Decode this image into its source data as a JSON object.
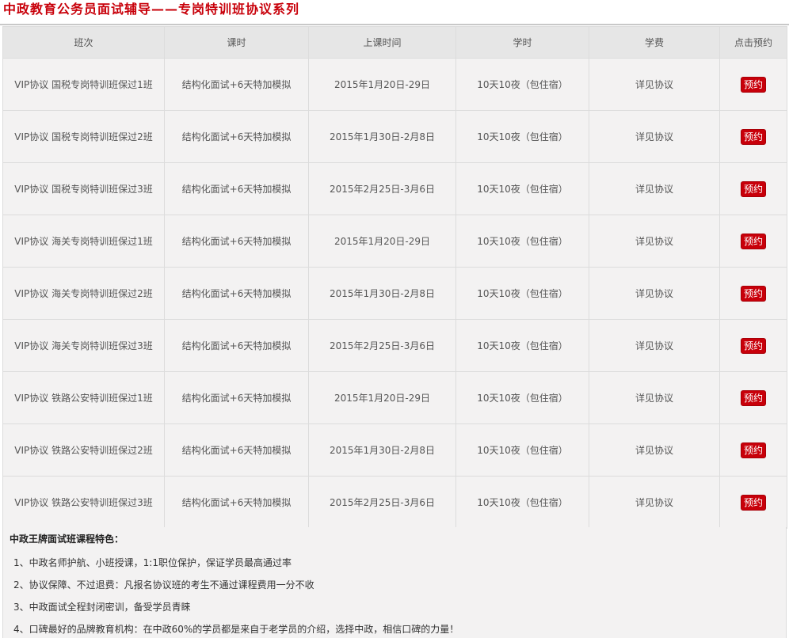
{
  "page_title": "中政教育公务员面试辅导——专岗特训班协议系列",
  "table": {
    "headers": [
      "班次",
      "课时",
      "上课时间",
      "学时",
      "学费",
      "点击预约"
    ],
    "rows": [
      {
        "class": "VIP协议 国税专岗特训班保过1班",
        "hours": "结构化面试+6天特加模拟",
        "time": "2015年1月20日-29日",
        "period": "10天10夜（包住宿）",
        "fee": "详见协议",
        "action": "预约"
      },
      {
        "class": "VIP协议 国税专岗特训班保过2班",
        "hours": "结构化面试+6天特加模拟",
        "time": "2015年1月30日-2月8日",
        "period": "10天10夜（包住宿）",
        "fee": "详见协议",
        "action": "预约"
      },
      {
        "class": "VIP协议 国税专岗特训班保过3班",
        "hours": "结构化面试+6天特加模拟",
        "time": "2015年2月25日-3月6日",
        "period": "10天10夜（包住宿）",
        "fee": "详见协议",
        "action": "预约"
      },
      {
        "class": "VIP协议 海关专岗特训班保过1班",
        "hours": "结构化面试+6天特加模拟",
        "time": "2015年1月20日-29日",
        "period": "10天10夜（包住宿）",
        "fee": "详见协议",
        "action": "预约"
      },
      {
        "class": "VIP协议 海关专岗特训班保过2班",
        "hours": "结构化面试+6天特加模拟",
        "time": "2015年1月30日-2月8日",
        "period": "10天10夜（包住宿）",
        "fee": "详见协议",
        "action": "预约"
      },
      {
        "class": "VIP协议 海关专岗特训班保过3班",
        "hours": "结构化面试+6天特加模拟",
        "time": "2015年2月25日-3月6日",
        "period": "10天10夜（包住宿）",
        "fee": "详见协议",
        "action": "预约"
      },
      {
        "class": "VIP协议 铁路公安特训班保过1班",
        "hours": "结构化面试+6天特加模拟",
        "time": "2015年1月20日-29日",
        "period": "10天10夜（包住宿）",
        "fee": "详见协议",
        "action": "预约"
      },
      {
        "class": "VIP协议 铁路公安特训班保过2班",
        "hours": "结构化面试+6天特加模拟",
        "time": "2015年1月30日-2月8日",
        "period": "10天10夜（包住宿）",
        "fee": "详见协议",
        "action": "预约"
      },
      {
        "class": "VIP协议 铁路公安特训班保过3班",
        "hours": "结构化面试+6天特加模拟",
        "time": "2015年2月25日-3月6日",
        "period": "10天10夜（包住宿）",
        "fee": "详见协议",
        "action": "预约"
      }
    ]
  },
  "features": {
    "title": "中政王牌面试班课程特色：",
    "items": [
      "1、中政名师护航、小班授课，1:1职位保护，保证学员最高通过率",
      "2、协议保障、不过退费：凡报名协议班的考生不通过课程费用一分不收",
      "3、中政面试全程封闭密训，备受学员青睐",
      "4、口碑最好的品牌教育机构：在中政60%的学员都是来自于老学员的介绍，选择中政，相信口碑的力量！"
    ]
  },
  "colors": {
    "brand_red": "#c8000a",
    "row_bg": "#f3f2f2",
    "header_bg": "#e6e6e6"
  }
}
